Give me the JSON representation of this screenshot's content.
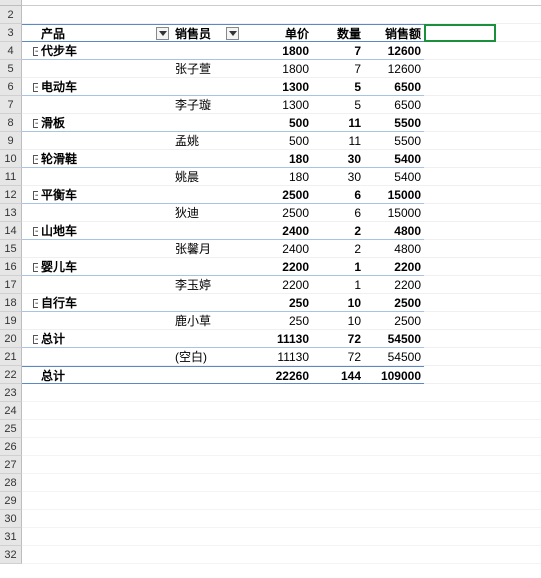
{
  "chart_data": {
    "type": "table",
    "title": "PivotTable",
    "columns": [
      "产品",
      "销售员",
      "单价",
      "数量",
      "销售额"
    ],
    "rows": [
      {
        "product": "代步车",
        "seller_subtotal": true,
        "unit_price": 1800,
        "qty": 7,
        "sales": 12600
      },
      {
        "product": "代步车",
        "seller": "张子萱",
        "unit_price": 1800,
        "qty": 7,
        "sales": 12600
      },
      {
        "product": "电动车",
        "seller_subtotal": true,
        "unit_price": 1300,
        "qty": 5,
        "sales": 6500
      },
      {
        "product": "电动车",
        "seller": "李子璇",
        "unit_price": 1300,
        "qty": 5,
        "sales": 6500
      },
      {
        "product": "滑板",
        "seller_subtotal": true,
        "unit_price": 500,
        "qty": 11,
        "sales": 5500
      },
      {
        "product": "滑板",
        "seller": "孟姚",
        "unit_price": 500,
        "qty": 11,
        "sales": 5500
      },
      {
        "product": "轮滑鞋",
        "seller_subtotal": true,
        "unit_price": 180,
        "qty": 30,
        "sales": 5400
      },
      {
        "product": "轮滑鞋",
        "seller": "姚晨",
        "unit_price": 180,
        "qty": 30,
        "sales": 5400
      },
      {
        "product": "平衡车",
        "seller_subtotal": true,
        "unit_price": 2500,
        "qty": 6,
        "sales": 15000
      },
      {
        "product": "平衡车",
        "seller": "狄迪",
        "unit_price": 2500,
        "qty": 6,
        "sales": 15000
      },
      {
        "product": "山地车",
        "seller_subtotal": true,
        "unit_price": 2400,
        "qty": 2,
        "sales": 4800
      },
      {
        "product": "山地车",
        "seller": "张馨月",
        "unit_price": 2400,
        "qty": 2,
        "sales": 4800
      },
      {
        "product": "婴儿车",
        "seller_subtotal": true,
        "unit_price": 2200,
        "qty": 1,
        "sales": 2200
      },
      {
        "product": "婴儿车",
        "seller": "李玉婷",
        "unit_price": 2200,
        "qty": 1,
        "sales": 2200
      },
      {
        "product": "自行车",
        "seller_subtotal": true,
        "unit_price": 250,
        "qty": 10,
        "sales": 2500
      },
      {
        "product": "自行车",
        "seller": "鹿小草",
        "unit_price": 250,
        "qty": 10,
        "sales": 2500
      },
      {
        "product": "总计",
        "seller_subtotal": true,
        "unit_price": 11130,
        "qty": 72,
        "sales": 54500
      },
      {
        "product": "总计",
        "seller": "(空白)",
        "unit_price": 11130,
        "qty": 72,
        "sales": 54500
      }
    ],
    "grand_total": {
      "label": "总计",
      "unit_price": 22260,
      "qty": 144,
      "sales": 109000
    }
  },
  "hdr": {
    "product": "产品",
    "seller": "销售员",
    "price": "单价",
    "qty": "数量",
    "sales": "销售额"
  },
  "rows": [
    {
      "n": "4",
      "prod": "代步车",
      "seller": "",
      "p": "1800",
      "q": "7",
      "s": "12600",
      "sub": true
    },
    {
      "n": "5",
      "prod": "",
      "seller": "张子萱",
      "p": "1800",
      "q": "7",
      "s": "12600",
      "sub": false
    },
    {
      "n": "6",
      "prod": "电动车",
      "seller": "",
      "p": "1300",
      "q": "5",
      "s": "6500",
      "sub": true
    },
    {
      "n": "7",
      "prod": "",
      "seller": "李子璇",
      "p": "1300",
      "q": "5",
      "s": "6500",
      "sub": false
    },
    {
      "n": "8",
      "prod": "滑板",
      "seller": "",
      "p": "500",
      "q": "11",
      "s": "5500",
      "sub": true
    },
    {
      "n": "9",
      "prod": "",
      "seller": "孟姚",
      "p": "500",
      "q": "11",
      "s": "5500",
      "sub": false
    },
    {
      "n": "10",
      "prod": "轮滑鞋",
      "seller": "",
      "p": "180",
      "q": "30",
      "s": "5400",
      "sub": true
    },
    {
      "n": "11",
      "prod": "",
      "seller": "姚晨",
      "p": "180",
      "q": "30",
      "s": "5400",
      "sub": false
    },
    {
      "n": "12",
      "prod": "平衡车",
      "seller": "",
      "p": "2500",
      "q": "6",
      "s": "15000",
      "sub": true
    },
    {
      "n": "13",
      "prod": "",
      "seller": "狄迪",
      "p": "2500",
      "q": "6",
      "s": "15000",
      "sub": false
    },
    {
      "n": "14",
      "prod": "山地车",
      "seller": "",
      "p": "2400",
      "q": "2",
      "s": "4800",
      "sub": true
    },
    {
      "n": "15",
      "prod": "",
      "seller": "张馨月",
      "p": "2400",
      "q": "2",
      "s": "4800",
      "sub": false
    },
    {
      "n": "16",
      "prod": "婴儿车",
      "seller": "",
      "p": "2200",
      "q": "1",
      "s": "2200",
      "sub": true
    },
    {
      "n": "17",
      "prod": "",
      "seller": "李玉婷",
      "p": "2200",
      "q": "1",
      "s": "2200",
      "sub": false
    },
    {
      "n": "18",
      "prod": "自行车",
      "seller": "",
      "p": "250",
      "q": "10",
      "s": "2500",
      "sub": true
    },
    {
      "n": "19",
      "prod": "",
      "seller": "鹿小草",
      "p": "250",
      "q": "10",
      "s": "2500",
      "sub": false
    },
    {
      "n": "20",
      "prod": "总计",
      "seller": "",
      "p": "11130",
      "q": "72",
      "s": "54500",
      "sub": true
    },
    {
      "n": "21",
      "prod": "",
      "seller": "(空白)",
      "p": "11130",
      "q": "72",
      "s": "54500",
      "sub": false
    }
  ],
  "grand": {
    "n": "22",
    "label": "总计",
    "p": "22260",
    "q": "144",
    "s": "109000"
  },
  "emptyRows": [
    "23",
    "24",
    "25",
    "26",
    "27",
    "28",
    "29",
    "30",
    "31",
    "32"
  ],
  "row2": "2",
  "hdrRow": "3",
  "collapseGlyph": "−"
}
